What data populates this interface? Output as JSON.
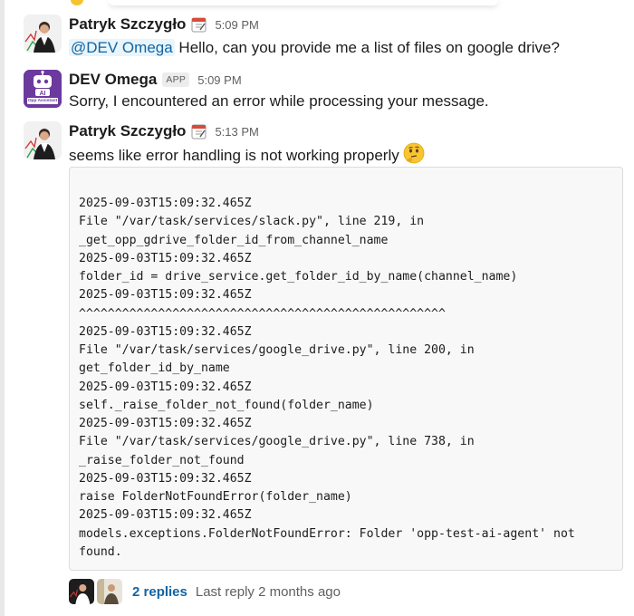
{
  "messages": [
    {
      "author": "Patryk Szczygło",
      "status_icon": "calendar-icon",
      "timestamp": "5:09 PM",
      "mention": "@DEV Omega",
      "text": " Hello, can you provide me a list of files on google drive?"
    },
    {
      "author": "DEV Omega",
      "badge": "APP",
      "timestamp": "5:09 PM",
      "text": "Sorry, I encountered an error while processing your message.",
      "avatar_label": "Opp Assistant"
    },
    {
      "author": "Patryk Szczygło",
      "status_icon": "calendar-icon",
      "timestamp": "5:13 PM",
      "text": "seems like error handling is not working properly",
      "emoji": "thinking-face-icon"
    }
  ],
  "code_lines": [
    "2025-09-03T15:09:32.465Z",
    "File \"/var/task/services/slack.py\", line 219, in",
    "_get_opp_gdrive_folder_id_from_channel_name",
    "2025-09-03T15:09:32.465Z",
    "folder_id = drive_service.get_folder_id_by_name(channel_name)",
    "2025-09-03T15:09:32.465Z",
    "^^^^^^^^^^^^^^^^^^^^^^^^^^^^^^^^^^^^^^^^^^^^^^^^^^^",
    "2025-09-03T15:09:32.465Z",
    "File \"/var/task/services/google_drive.py\", line 200, in",
    "get_folder_id_by_name",
    "2025-09-03T15:09:32.465Z",
    "self._raise_folder_not_found(folder_name)",
    "2025-09-03T15:09:32.465Z",
    "File \"/var/task/services/google_drive.py\", line 738, in",
    "_raise_folder_not_found",
    "2025-09-03T15:09:32.465Z",
    "raise FolderNotFoundError(folder_name)",
    "2025-09-03T15:09:32.465Z",
    "models.exceptions.FolderNotFoundError: Folder 'opp-test-ai-agent' not",
    "found."
  ],
  "thread": {
    "replies": "2 replies",
    "last_reply": "Last reply 2 months ago"
  },
  "colors": {
    "link": "#1264a3",
    "bot_avatar": "#6c3a9e",
    "code_bg": "#f8f8f8"
  }
}
